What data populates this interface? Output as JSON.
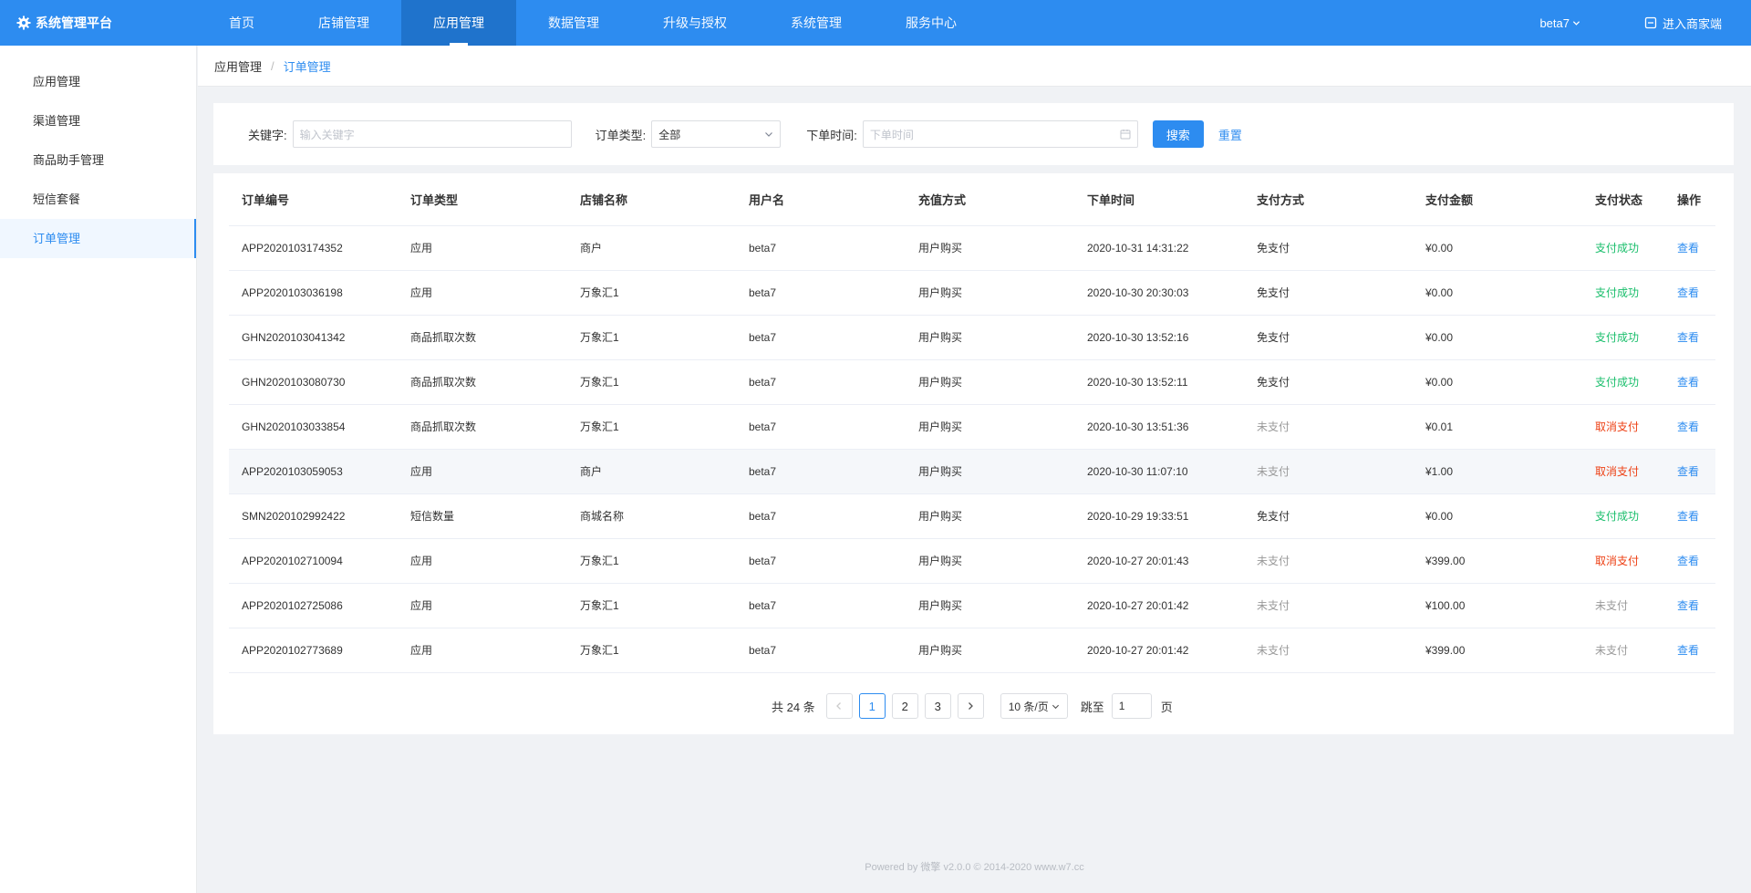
{
  "app": {
    "brand": "系统管理平台"
  },
  "nav": {
    "items": [
      {
        "label": "首页",
        "active": false
      },
      {
        "label": "店铺管理",
        "active": false
      },
      {
        "label": "应用管理",
        "active": true
      },
      {
        "label": "数据管理",
        "active": false
      },
      {
        "label": "升级与授权",
        "active": false
      },
      {
        "label": "系统管理",
        "active": false
      },
      {
        "label": "服务中心",
        "active": false
      }
    ],
    "user": "beta7",
    "merchant_link": "进入商家端"
  },
  "sidebar": {
    "items": [
      {
        "label": "应用管理",
        "active": false
      },
      {
        "label": "渠道管理",
        "active": false
      },
      {
        "label": "商品助手管理",
        "active": false
      },
      {
        "label": "短信套餐",
        "active": false
      },
      {
        "label": "订单管理",
        "active": true
      }
    ]
  },
  "breadcrumb": {
    "parent": "应用管理",
    "separator": "/",
    "current": "订单管理"
  },
  "filter": {
    "keyword_label": "关键字:",
    "keyword_placeholder": "输入关键字",
    "keyword_value": "",
    "type_label": "订单类型:",
    "type_value": "全部",
    "date_label": "下单时间:",
    "date_placeholder": "下单时间",
    "search_button": "搜索",
    "reset_button": "重置"
  },
  "table": {
    "columns": [
      "订单编号",
      "订单类型",
      "店铺名称",
      "用户名",
      "充值方式",
      "下单时间",
      "支付方式",
      "支付金额",
      "支付状态",
      "操作"
    ],
    "rows": [
      {
        "order_no": "APP2020103174352",
        "type": "应用",
        "shop": "商户",
        "user": "beta7",
        "recharge": "用户购买",
        "time": "2020-10-31 14:31:22",
        "pay_method": "免支付",
        "amount": "¥0.00",
        "status": "支付成功",
        "status_kind": "ok",
        "action": "查看"
      },
      {
        "order_no": "APP2020103036198",
        "type": "应用",
        "shop": "万象汇1",
        "user": "beta7",
        "recharge": "用户购买",
        "time": "2020-10-30 20:30:03",
        "pay_method": "免支付",
        "amount": "¥0.00",
        "status": "支付成功",
        "status_kind": "ok",
        "action": "查看"
      },
      {
        "order_no": "GHN2020103041342",
        "type": "商品抓取次数",
        "shop": "万象汇1",
        "user": "beta7",
        "recharge": "用户购买",
        "time": "2020-10-30 13:52:16",
        "pay_method": "免支付",
        "amount": "¥0.00",
        "status": "支付成功",
        "status_kind": "ok",
        "action": "查看"
      },
      {
        "order_no": "GHN2020103080730",
        "type": "商品抓取次数",
        "shop": "万象汇1",
        "user": "beta7",
        "recharge": "用户购买",
        "time": "2020-10-30 13:52:11",
        "pay_method": "免支付",
        "amount": "¥0.00",
        "status": "支付成功",
        "status_kind": "ok",
        "action": "查看"
      },
      {
        "order_no": "GHN2020103033854",
        "type": "商品抓取次数",
        "shop": "万象汇1",
        "user": "beta7",
        "recharge": "用户购买",
        "time": "2020-10-30 13:51:36",
        "pay_method": "未支付",
        "amount": "¥0.01",
        "status": "取消支付",
        "status_kind": "cancel",
        "action": "查看"
      },
      {
        "order_no": "APP2020103059053",
        "type": "应用",
        "shop": "商户",
        "user": "beta7",
        "recharge": "用户购买",
        "time": "2020-10-30 11:07:10",
        "pay_method": "未支付",
        "amount": "¥1.00",
        "status": "取消支付",
        "status_kind": "cancel",
        "action": "查看"
      },
      {
        "order_no": "SMN2020102992422",
        "type": "短信数量",
        "shop": "商城名称",
        "user": "beta7",
        "recharge": "用户购买",
        "time": "2020-10-29 19:33:51",
        "pay_method": "免支付",
        "amount": "¥0.00",
        "status": "支付成功",
        "status_kind": "ok",
        "action": "查看"
      },
      {
        "order_no": "APP2020102710094",
        "type": "应用",
        "shop": "万象汇1",
        "user": "beta7",
        "recharge": "用户购买",
        "time": "2020-10-27 20:01:43",
        "pay_method": "未支付",
        "amount": "¥399.00",
        "status": "取消支付",
        "status_kind": "cancel",
        "action": "查看"
      },
      {
        "order_no": "APP2020102725086",
        "type": "应用",
        "shop": "万象汇1",
        "user": "beta7",
        "recharge": "用户购买",
        "time": "2020-10-27 20:01:42",
        "pay_method": "未支付",
        "amount": "¥100.00",
        "status": "未支付",
        "status_kind": "none",
        "action": "查看"
      },
      {
        "order_no": "APP2020102773689",
        "type": "应用",
        "shop": "万象汇1",
        "user": "beta7",
        "recharge": "用户购买",
        "time": "2020-10-27 20:01:42",
        "pay_method": "未支付",
        "amount": "¥399.00",
        "status": "未支付",
        "status_kind": "none",
        "action": "查看"
      }
    ]
  },
  "pagination": {
    "total": "共 24 条",
    "pages": [
      "1",
      "2",
      "3"
    ],
    "current": "1",
    "page_size": "10 条/页",
    "jump_label": "跳至",
    "jump_value": "1",
    "page_suffix": "页"
  },
  "footer": {
    "text": "Powered by 微擎 v2.0.0 © 2014-2020 www.w7.cc"
  },
  "colors": {
    "primary": "#2d8cf0",
    "success": "#19be6b",
    "danger": "#ed4014",
    "muted": "#999999"
  }
}
